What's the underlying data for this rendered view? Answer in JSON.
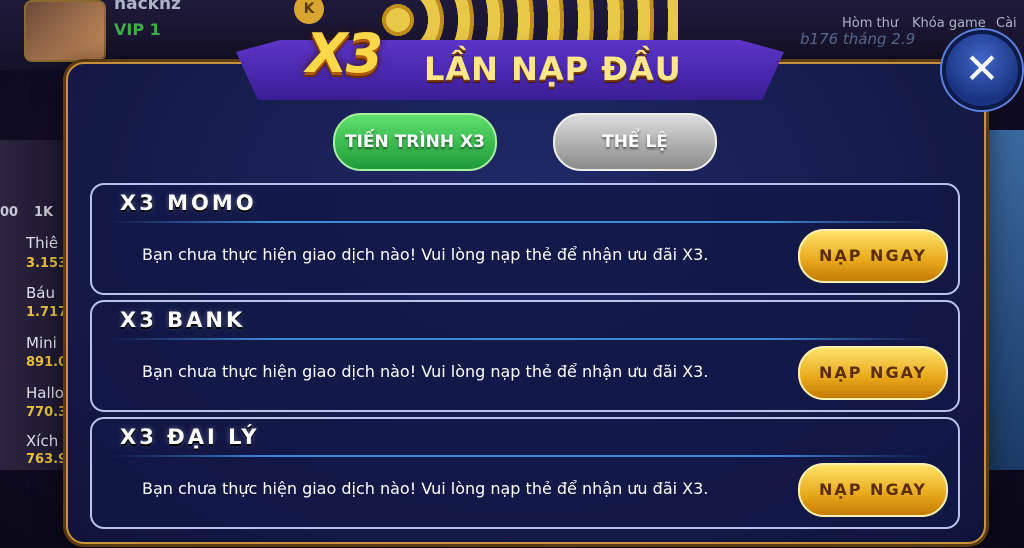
{
  "background": {
    "username": "hackhz",
    "vip": "VIP 1",
    "coin_letter": "K",
    "nav": [
      "Hòm thư",
      "Khóa game",
      "Cài"
    ],
    "chips": [
      "00",
      "1K"
    ],
    "leaderboard": [
      {
        "name": "Thiê",
        "value": "3.153"
      },
      {
        "name": "Báu",
        "value": "1.717"
      },
      {
        "name": "Mini",
        "value": "891.0"
      },
      {
        "name": "Hallo",
        "value": "770.3"
      },
      {
        "name": "Xích",
        "value": "763.9"
      }
    ],
    "right_text": "b176  tháng  2.9"
  },
  "dialog": {
    "banner": {
      "x3": "X3",
      "title": "LẦN NẠP ĐẦU"
    },
    "close_icon": "close-icon",
    "tabs": [
      {
        "label": "TIẾN TRÌNH X3",
        "active": true
      },
      {
        "label": "THỂ LỆ",
        "active": false
      }
    ],
    "cards": [
      {
        "title": "X3 MOMO",
        "message": "Bạn chưa thực hiện giao dịch nào! Vui lòng nạp thẻ để nhận ưu đãi X3.",
        "button": "NẠP NGAY"
      },
      {
        "title": "X3 BANK",
        "message": "Bạn chưa thực hiện giao dịch nào! Vui lòng nạp thẻ để nhận ưu đãi X3.",
        "button": "NẠP NGAY"
      },
      {
        "title": "X3 ĐẠI LÝ",
        "message": "Bạn chưa thực hiện giao dịch nào! Vui lòng nạp thẻ để nhận ưu đãi X3.",
        "button": "NẠP NGAY"
      }
    ]
  },
  "colors": {
    "accent_gold": "#e8a81a",
    "tab_active": "#1f9a3a",
    "tab_inactive": "#8a8a8a",
    "dialog_bg": "#161c4c"
  }
}
